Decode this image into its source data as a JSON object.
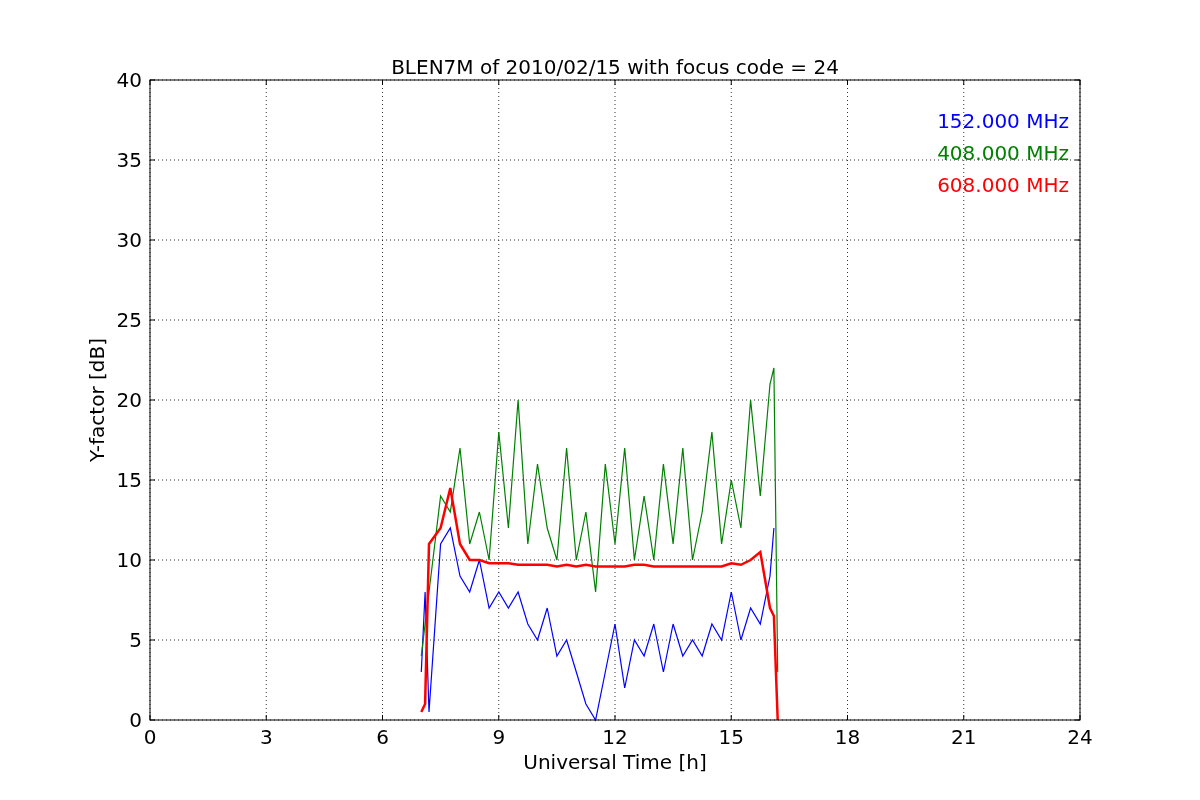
{
  "chart_data": {
    "type": "line",
    "title": "BLEN7M of 2010/02/15 with focus code = 24",
    "xlabel": "Universal Time [h]",
    "ylabel": "Y-factor [dB]",
    "x": [
      7.0,
      7.1,
      7.2,
      7.5,
      7.75,
      8,
      8.25,
      8.5,
      8.75,
      9,
      9.25,
      9.5,
      9.75,
      10,
      10.25,
      10.5,
      10.75,
      11,
      11.25,
      11.5,
      11.75,
      12,
      12.25,
      12.5,
      12.75,
      13,
      13.25,
      13.5,
      13.75,
      14,
      14.25,
      14.5,
      14.75,
      15,
      15.25,
      15.5,
      15.75,
      16,
      16.1,
      16.2
    ],
    "series": [
      {
        "name": "152.000 MHz",
        "color": "#0000ff",
        "values": [
          3,
          8,
          0.5,
          11,
          12,
          9,
          8,
          10,
          7,
          8,
          7,
          8,
          6,
          5,
          7,
          4,
          5,
          3,
          1,
          0,
          3,
          6,
          2,
          5,
          4,
          6,
          3,
          6,
          4,
          5,
          4,
          6,
          5,
          8,
          5,
          7,
          6,
          9,
          12,
          null
        ]
      },
      {
        "name": "408.000 MHz",
        "color": "#008000",
        "values": [
          4,
          6,
          8,
          14,
          13,
          17,
          11,
          13,
          10,
          18,
          12,
          20,
          11,
          16,
          12,
          10,
          17,
          10,
          13,
          8,
          16,
          11,
          17,
          10,
          14,
          10,
          16,
          11,
          17,
          10,
          13,
          18,
          11,
          15,
          12,
          20,
          14,
          21,
          22,
          3
        ]
      },
      {
        "name": "608.000 MHz",
        "color": "#ff0000",
        "values": [
          0.5,
          1,
          11,
          12,
          14.5,
          11,
          10,
          10,
          9.8,
          9.8,
          9.8,
          9.7,
          9.7,
          9.7,
          9.7,
          9.6,
          9.7,
          9.6,
          9.7,
          9.6,
          9.6,
          9.6,
          9.6,
          9.7,
          9.7,
          9.6,
          9.6,
          9.6,
          9.6,
          9.6,
          9.6,
          9.6,
          9.6,
          9.8,
          9.7,
          10,
          10.5,
          7,
          6.5,
          0
        ]
      }
    ],
    "xlim": [
      0,
      24
    ],
    "ylim": [
      0,
      40
    ],
    "xticks": [
      0,
      3,
      6,
      9,
      12,
      15,
      18,
      21,
      24
    ],
    "yticks": [
      0,
      5,
      10,
      15,
      20,
      25,
      30,
      35,
      40
    ],
    "grid": true
  }
}
